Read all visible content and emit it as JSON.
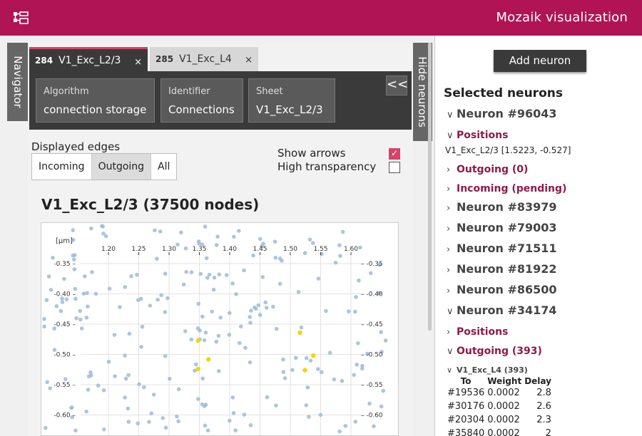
{
  "header": {
    "title": "Mozaik visualization",
    "logo_icon": "network-tree-icon",
    "color": "#b01455"
  },
  "side_tabs": {
    "navigator": "Navigator",
    "hide_neurons": "Hide neurons"
  },
  "tabs": [
    {
      "num": "284",
      "label": "V1_Exc_L2/3",
      "close": "×",
      "active": true
    },
    {
      "num": "285",
      "label": "V1_Exc_L4",
      "close": "×",
      "active": false
    }
  ],
  "info_bar": {
    "algorithm": {
      "label": "Algorithm",
      "value": "connection storage"
    },
    "identifier": {
      "label": "Identifier",
      "value": "Connections"
    },
    "sheet": {
      "label": "Sheet",
      "value": "V1_Exc_L2/3"
    },
    "collapse": "<<"
  },
  "edges": {
    "label": "Displayed edges",
    "options": [
      "Incoming",
      "Outgoing",
      "All"
    ],
    "selected": "Outgoing"
  },
  "options": {
    "show_arrows": {
      "label": "Show arrows",
      "checked": true
    },
    "high_transparency": {
      "label": "High transparency",
      "checked": false
    }
  },
  "graph": {
    "title": "V1_Exc_L2/3 (37500 nodes)"
  },
  "chart_data": {
    "type": "scatter",
    "xlabel": "[μm]",
    "x_ticks": [
      "1.20",
      "1.25",
      "1.30",
      "1.35",
      "1.40",
      "1.45",
      "1.50",
      "1.55",
      "1.60"
    ],
    "y_ticks": [
      "-0.35",
      "-0.40",
      "-0.45",
      "-0.50",
      "-0.55",
      "-0.60"
    ],
    "xlim": [
      1.1,
      1.7
    ],
    "ylim": [
      -0.62,
      -0.31
    ],
    "colors": {
      "nodes": "#9dbbd8",
      "targets": "#f5d400"
    },
    "highlighted_points": [
      {
        "x": 1.348,
        "y": -0.477
      },
      {
        "x": 1.365,
        "y": -0.508
      },
      {
        "x": 1.348,
        "y": -0.524
      },
      {
        "x": 1.516,
        "y": -0.464
      },
      {
        "x": 1.538,
        "y": -0.502
      },
      {
        "x": 1.524,
        "y": -0.526
      }
    ]
  },
  "right_panel": {
    "add_button": "Add neuron",
    "title": "Selected neurons",
    "neuron1": "Neuron #96043",
    "positions1": "Positions",
    "position_value": "V1_Exc_L2/3 [1.5223, -0.527]",
    "outgoing0": "Outgoing (0)",
    "incoming_pending": "Incoming (pending)",
    "others": [
      "Neuron #83979",
      "Neuron #79003",
      "Neuron #71511",
      "Neuron #81922",
      "Neuron #86500"
    ],
    "neuron_expanded": "Neuron #34174",
    "positions2": "Positions",
    "outgoing393": "Outgoing (393)",
    "subgroup": "V1_Exc_L4 (393)",
    "table": {
      "headers": [
        "To",
        "Weight",
        "Delay"
      ],
      "rows": [
        [
          "#19536",
          "0.0002",
          "2.8"
        ],
        [
          "#30176",
          "0.0002",
          "2.6"
        ],
        [
          "#20304",
          "0.0002",
          "2.3"
        ],
        [
          "#35840",
          "0.0002",
          "2"
        ]
      ]
    }
  }
}
